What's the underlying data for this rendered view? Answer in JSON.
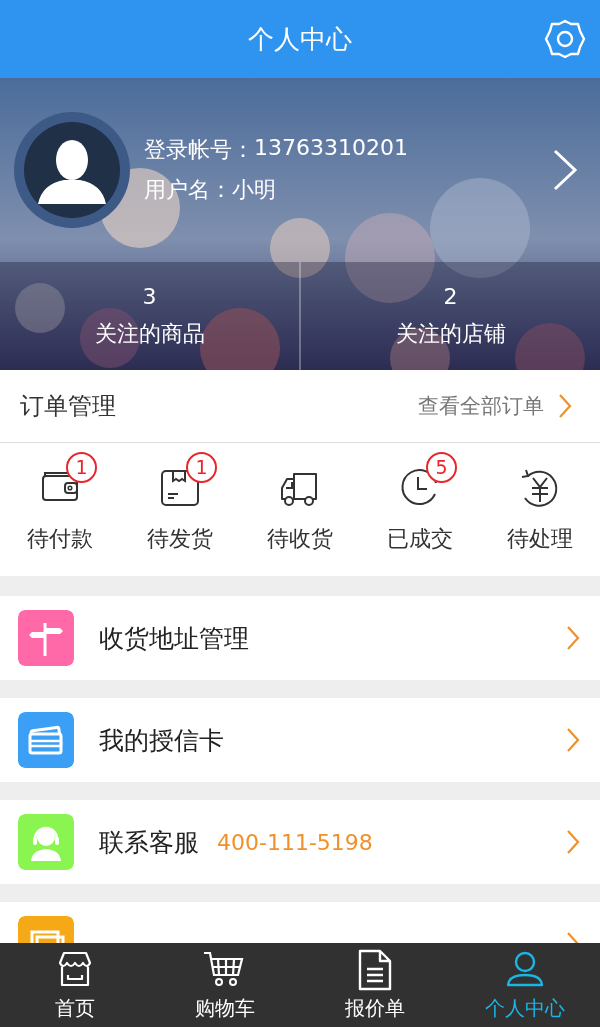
{
  "header": {
    "title": "个人中心"
  },
  "profile": {
    "account_label": "登录帐号：",
    "account": "13763310201",
    "username_label": "用户名：",
    "username": "小明",
    "stats": [
      {
        "count": "3",
        "label": "关注的商品"
      },
      {
        "count": "2",
        "label": "关注的店铺"
      }
    ]
  },
  "orders": {
    "title": "订单管理",
    "view_all": "查看全部订单",
    "statuses": [
      {
        "kind": "wallet",
        "label": "待付款",
        "badge": "1"
      },
      {
        "kind": "box",
        "label": "待发货",
        "badge": "1"
      },
      {
        "kind": "truck",
        "label": "待收货"
      },
      {
        "kind": "clock",
        "label": "已成交",
        "badge": "5"
      },
      {
        "kind": "yuan",
        "label": "待处理"
      }
    ]
  },
  "menu": [
    {
      "kind": "signpost",
      "color": "#ff69a8",
      "label": "收货地址管理"
    },
    {
      "kind": "cards",
      "color": "#3b9ff5",
      "label": "我的授信卡"
    },
    {
      "kind": "agent",
      "color": "#8af550",
      "label": "联系客服",
      "phone": "400-111-5198"
    },
    {
      "kind": "stack",
      "color": "#f5a916"
    }
  ],
  "tabs": [
    {
      "kind": "store",
      "label": "首页",
      "selected": false
    },
    {
      "kind": "cart",
      "label": "购物车",
      "selected": false
    },
    {
      "kind": "doc",
      "label": "报价单",
      "selected": false
    },
    {
      "kind": "person",
      "label": "个人中心",
      "selected": true
    }
  ]
}
